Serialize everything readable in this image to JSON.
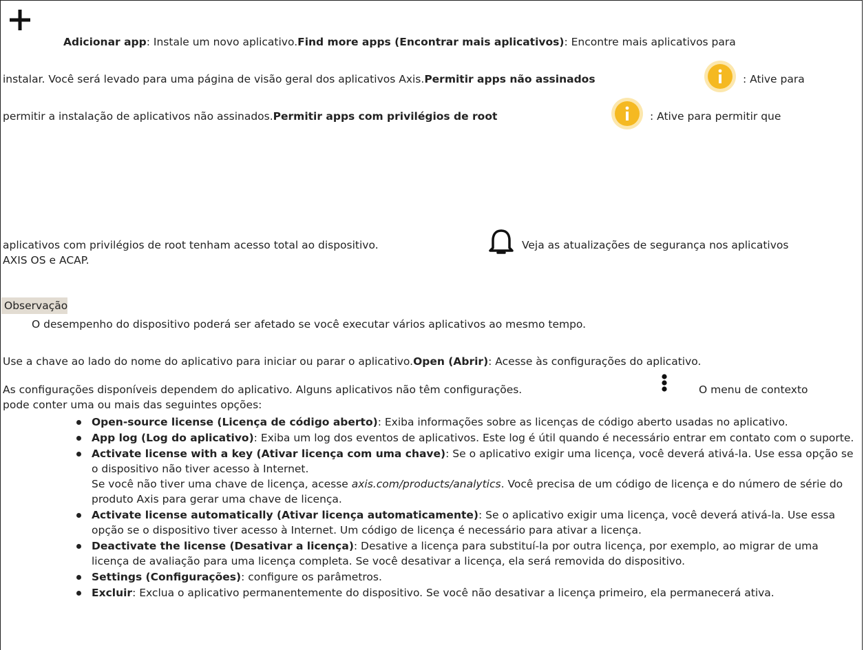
{
  "icons": {
    "plus": "plus-icon",
    "info": "info-icon",
    "bell": "bell-icon",
    "context_menu": "vertical-dots-icon",
    "info_color": "#f5b921"
  },
  "line1": {
    "add_label": "Adicionar app",
    "add_desc": ": Instale um novo aplicativo.",
    "find_label": "Find more apps (Encontrar mais aplicativos)",
    "find_desc": ": Encontre mais aplicativos para"
  },
  "line2": {
    "text": "instalar. Você será levado para uma página de visão geral dos aplicativos Axis.",
    "unsigned_label": "Permitir apps não assinados",
    "unsigned_desc": ": Ative para"
  },
  "line3": {
    "text": "permitir a instalação de aplicativos não assinados.",
    "root_label": "Permitir apps com privilégios de root",
    "root_desc": ": Ative para permitir que"
  },
  "line4": {
    "text": "aplicativos com privilégios de root tenham acesso total ao dispositivo.",
    "security_text": "Veja as atualizações de segurança nos aplicativos"
  },
  "line5": {
    "text": "AXIS OS e ACAP."
  },
  "note": {
    "label": "Observação",
    "text": "O desempenho do dispositivo poderá ser afetado se você executar vários aplicativos ao mesmo tempo."
  },
  "para1": {
    "text": "Use a chave ao lado do nome do aplicativo para iniciar ou parar o aplicativo.",
    "open_label": "Open (Abrir)",
    "open_desc": ": Acesse às configurações do aplicativo."
  },
  "para2": {
    "text": "As configurações disponíveis dependem do aplicativo. Alguns aplicativos não têm configurações.",
    "menu_text": "O menu de contexto",
    "line2": "pode conter uma ou mais das seguintes opções:"
  },
  "options": [
    {
      "label": "Open-source license (Licença de código aberto)",
      "desc": ": Exiba informações sobre as licenças de código aberto usadas no aplicativo."
    },
    {
      "label": "App log (Log do aplicativo)",
      "desc": ": Exiba um log dos eventos de aplicativos. Este log é útil quando é necessário entrar em contato com o suporte."
    },
    {
      "label": "Activate license with a key (Ativar licença com uma chave)",
      "desc": ": Se o aplicativo exigir uma licença, você deverá ativá-la. Use essa opção se o dispositivo não tiver acesso à Internet.",
      "extra_before": "Se você não tiver uma chave de licença, acesse ",
      "extra_link": "axis.com/products/analytics",
      "extra_after": ". Você precisa de um código de licença e do número de série do produto Axis para gerar uma chave de licença."
    },
    {
      "label": "Activate license automatically (Ativar licença automaticamente)",
      "desc": ": Se o aplicativo exigir uma licença, você deverá ativá-la. Use essa opção se o dispositivo tiver acesso à Internet. Um código de licença é necessário para ativar a licença."
    },
    {
      "label": "Deactivate the license (Desativar a licença)",
      "desc": ": Desative a licença para substituí-la por outra licença, por exemplo, ao migrar de uma licença de avaliação para uma licença completa. Se você desativar a licença, ela será removida do dispositivo."
    },
    {
      "label": "Settings (Configurações)",
      "desc": ": configure os parâmetros."
    },
    {
      "label": "Excluir",
      "desc": ": Exclua o aplicativo permanentemente do dispositivo. Se você não desativar a licença primeiro, ela permanecerá ativa."
    }
  ]
}
